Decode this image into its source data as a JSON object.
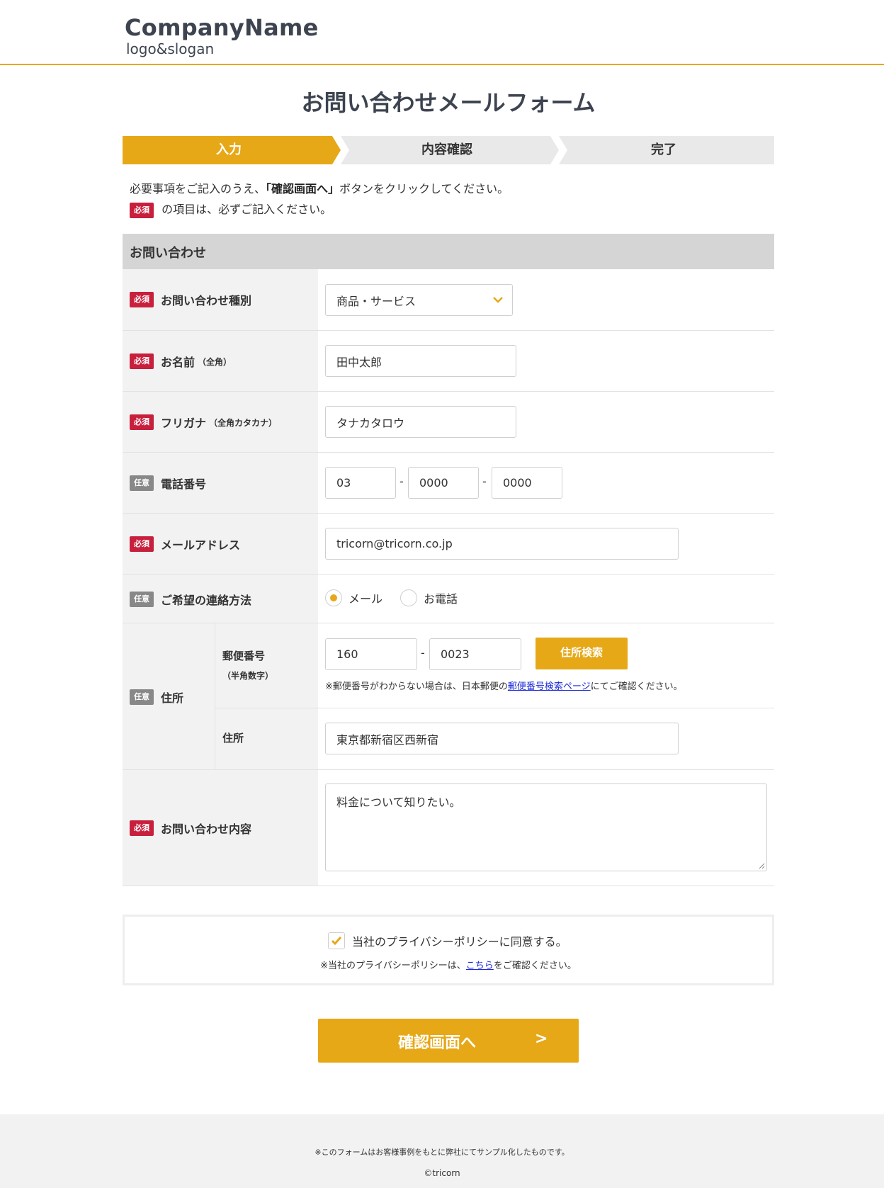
{
  "header": {
    "company_name": "CompanyName",
    "slogan": "logo&slogan"
  },
  "page_title": "お問い合わせメールフォーム",
  "steps": [
    {
      "label": "入力",
      "active": true
    },
    {
      "label": "内容確認",
      "active": false
    },
    {
      "label": "完了",
      "active": false
    }
  ],
  "intro": {
    "line1_pre": "必要事項をご記入のうえ、",
    "line1_bold": "「確認画面へ」",
    "line1_post": "ボタンをクリックしてください。",
    "line2": "の項目は、必ずご記入ください。"
  },
  "badges": {
    "required": "必須",
    "optional": "任意"
  },
  "section_title": "お問い合わせ",
  "fields": {
    "inquiry_type": {
      "label": "お問い合わせ種別",
      "value": "商品・サービス"
    },
    "name": {
      "label": "お名前",
      "note": "（全角）",
      "value": "田中太郎"
    },
    "furigana": {
      "label": "フリガナ",
      "note": "（全角カタカナ）",
      "value": "タナカタロウ"
    },
    "phone": {
      "label": "電話番号",
      "part1": "03",
      "part2": "0000",
      "part3": "0000",
      "separator": "-"
    },
    "email": {
      "label": "メールアドレス",
      "value": "tricorn@tricorn.co.jp"
    },
    "contact_method": {
      "label": "ご希望の連絡方法",
      "options": [
        "メール",
        "お電話"
      ],
      "selected": 0
    },
    "address": {
      "label": "住所",
      "zip_label": "郵便番号",
      "zip_note": "（半角数字）",
      "zip1": "160",
      "zip2": "0023",
      "zip_button": "住所検索",
      "zip_help_pre": "※郵便番号がわからない場合は、日本郵便の",
      "zip_help_link": "郵便番号検索ページ",
      "zip_help_post": "にてご確認ください。",
      "addr_label": "住所",
      "addr_value": "東京都新宿区西新宿"
    },
    "message": {
      "label": "お問い合わせ内容",
      "value": "料金について知りたい。"
    }
  },
  "privacy": {
    "checkbox_label": "当社のプライバシーポリシーに同意する。",
    "checked": true,
    "note_pre": "※当社のプライバシーポリシーは、",
    "note_link": "こちら",
    "note_post": "をご確認ください。"
  },
  "submit": {
    "label": "確認画面へ",
    "arrow": ">"
  },
  "footer": {
    "note": "※このフォームはお客様事例をもとに弊社にてサンプル化したものです。",
    "copyright": "©tricorn"
  },
  "colors": {
    "accent": "#e6a817",
    "required": "#c81f3d",
    "optional": "#888888",
    "link": "#1a27d6"
  }
}
